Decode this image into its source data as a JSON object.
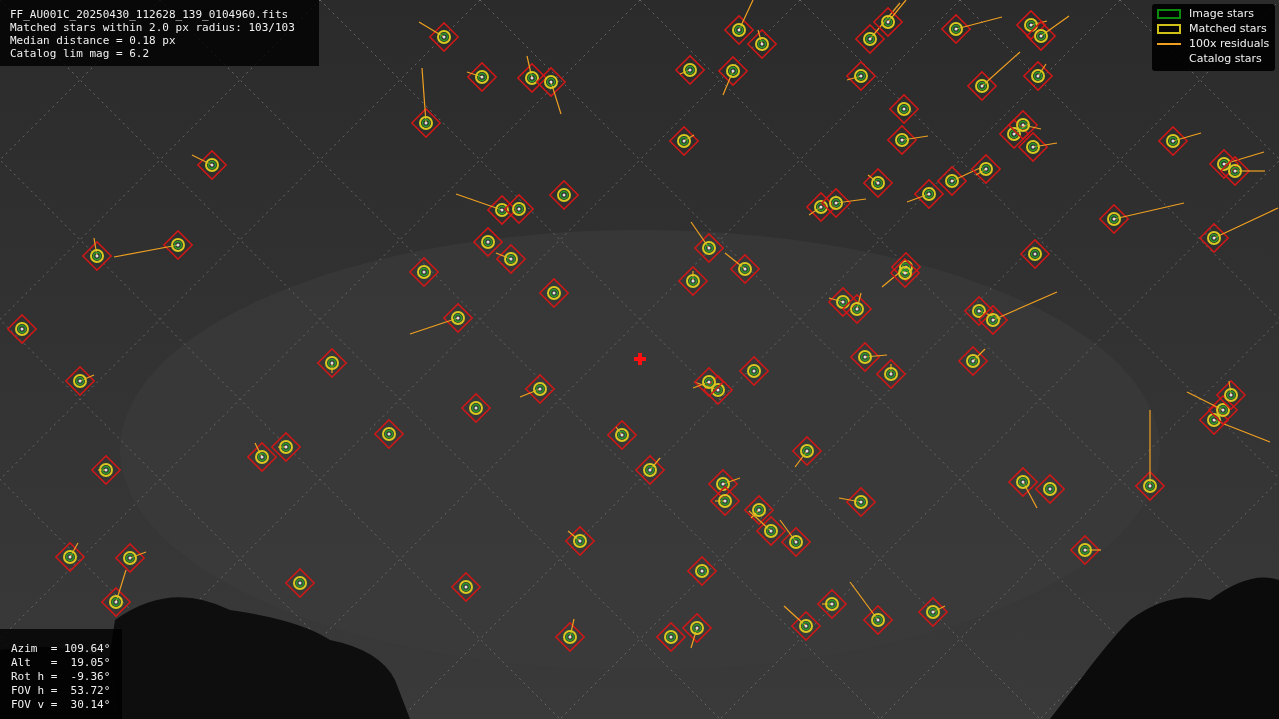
{
  "info": {
    "lines": [
      "FF_AU001C_20250430_112628_139_0104960.fits",
      "Matched stars within 2.0 px radius: 103/103",
      "Median distance = 0.18 px",
      "Catalog lim mag = 6.2"
    ]
  },
  "legend": [
    {
      "label": "Image stars"
    },
    {
      "kind": "matched",
      "label": "Matched stars"
    },
    {
      "kind": "residual",
      "label": "100x residuals"
    },
    {
      "kind": "catalog",
      "label": "Catalog stars"
    }
  ],
  "pointing": {
    "lines": [
      "Azim  = 109.64°",
      "Alt   =  19.05°",
      "Rot h =  -9.36°",
      "FOV h =  53.72°",
      "FOV v =  30.14°"
    ]
  }
}
